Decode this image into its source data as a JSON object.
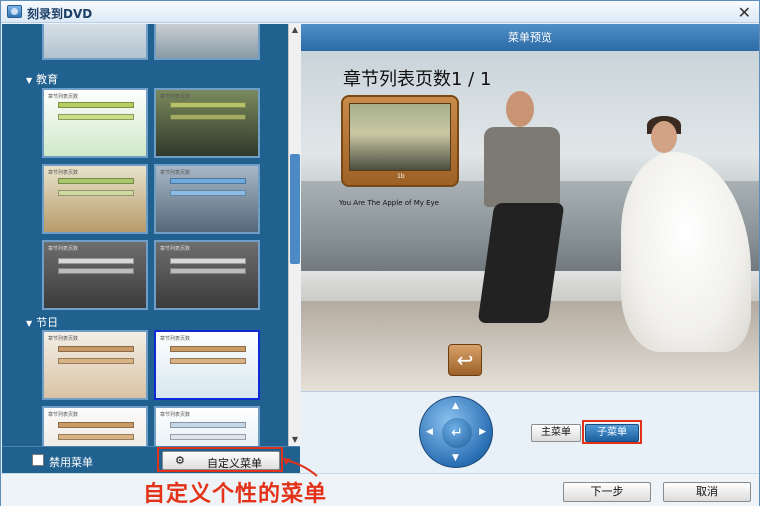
{
  "window": {
    "title": "刻录到DVD"
  },
  "left": {
    "categories": [
      {
        "label": "教育"
      },
      {
        "label": "节日"
      }
    ],
    "thumb_caption": "章节列表页数",
    "disable_menu_label": "禁用菜单",
    "custom_menu_label": "自定义菜单"
  },
  "right": {
    "header": "菜单预览",
    "chapter_title": "章节列表页数1 / 1",
    "chapter_caption": "You Are The Apple of My Eye",
    "frame_number": "1b",
    "main_menu_label": "主菜单",
    "sub_menu_label": "子菜单"
  },
  "annotation": {
    "text": "自定义个性的菜单"
  },
  "buttons": {
    "next": "下一步",
    "cancel": "取消"
  },
  "colors": {
    "accent": "#e0321b",
    "panel": "#21618f",
    "header": "#2d6aa6"
  }
}
